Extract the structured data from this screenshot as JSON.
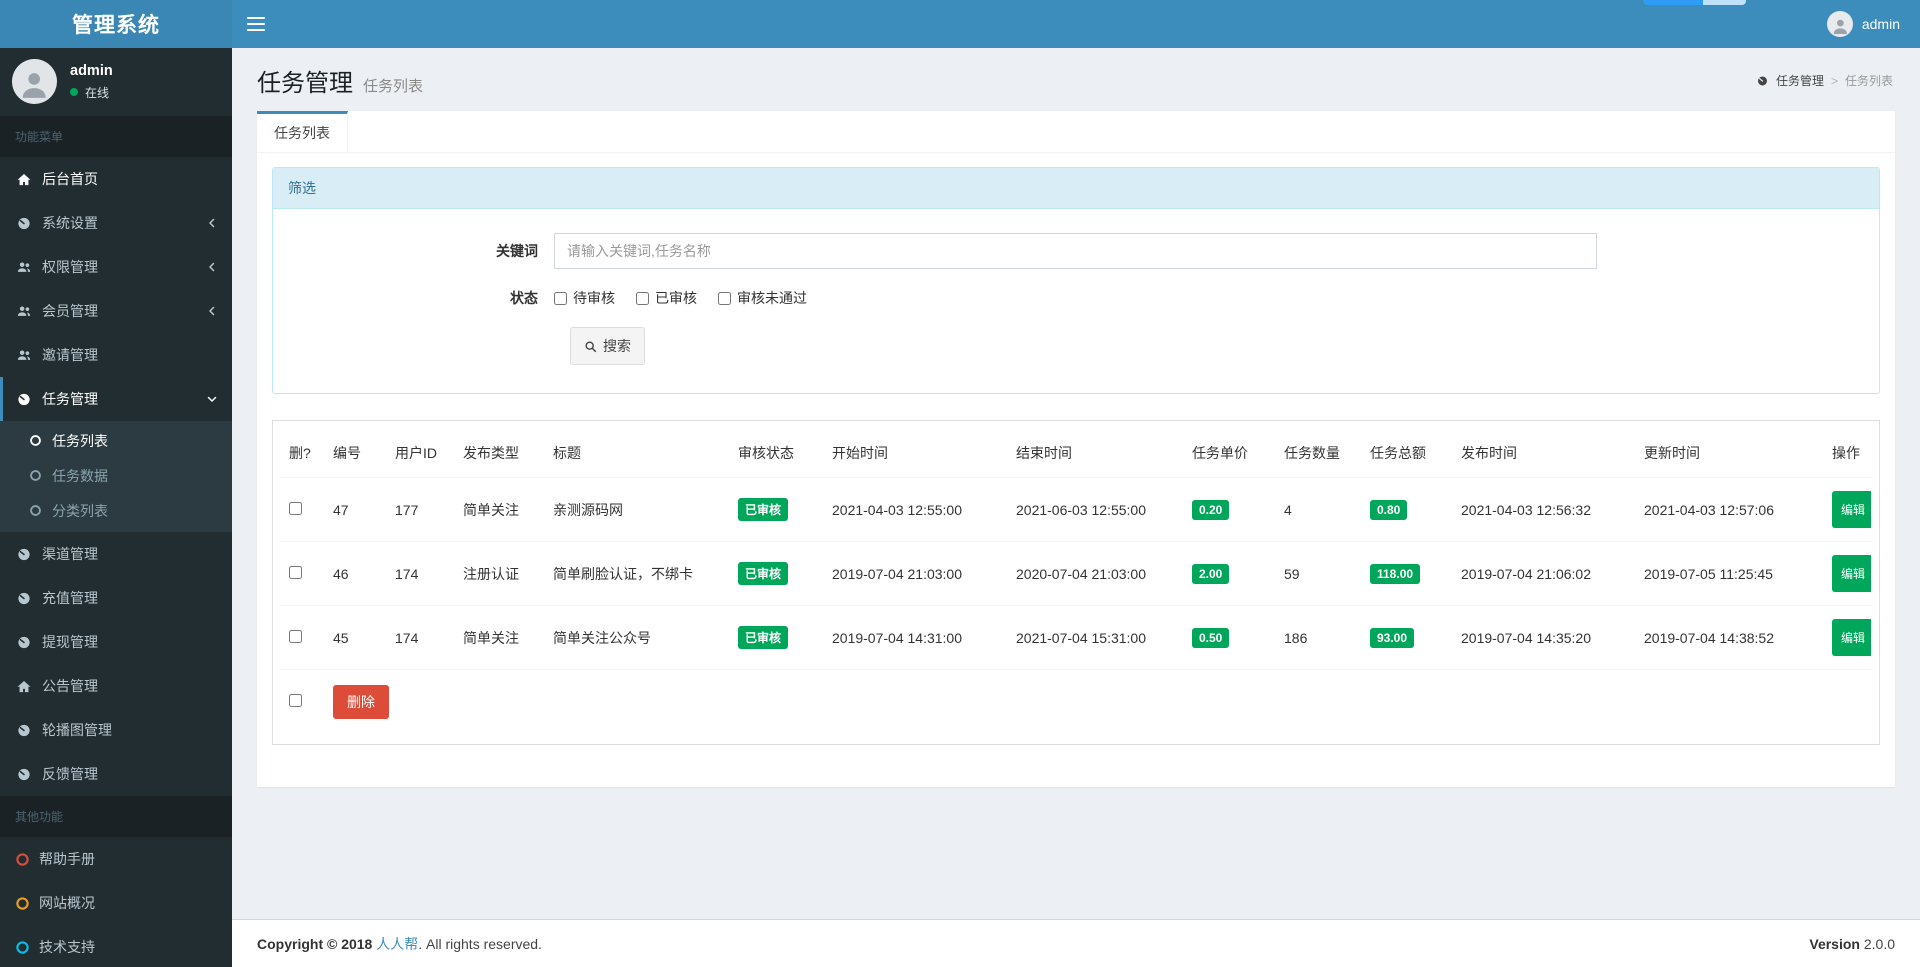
{
  "app": {
    "title": "管理系统"
  },
  "topbar": {
    "username": "admin"
  },
  "sidebar": {
    "user": {
      "name": "admin",
      "status": "在线"
    },
    "menu_header": "功能菜单",
    "items": [
      {
        "label": "后台首页",
        "icon": "home"
      },
      {
        "label": "系统设置",
        "icon": "gauge"
      },
      {
        "label": "权限管理",
        "icon": "users"
      },
      {
        "label": "会员管理",
        "icon": "users"
      },
      {
        "label": "邀请管理",
        "icon": "users"
      },
      {
        "label": "任务管理",
        "icon": "gauge",
        "active": true,
        "children": [
          {
            "label": "任务列表",
            "active": true
          },
          {
            "label": "任务数据"
          },
          {
            "label": "分类列表"
          }
        ]
      },
      {
        "label": "渠道管理",
        "icon": "gauge"
      },
      {
        "label": "充值管理",
        "icon": "gauge"
      },
      {
        "label": "提现管理",
        "icon": "gauge"
      },
      {
        "label": "公告管理",
        "icon": "home"
      },
      {
        "label": "轮播图管理",
        "icon": "gauge"
      },
      {
        "label": "反馈管理",
        "icon": "gauge"
      }
    ],
    "other_header": "其他功能",
    "other_items": [
      {
        "label": "帮助手册",
        "color": "#dd4b39"
      },
      {
        "label": "网站概况",
        "color": "#f39c12"
      },
      {
        "label": "技术支持",
        "color": "#00c0ef"
      }
    ]
  },
  "content_header": {
    "title": "任务管理",
    "subtitle": "任务列表",
    "breadcrumb": {
      "root": "任务管理",
      "separator": ">",
      "current": "任务列表"
    }
  },
  "tab": {
    "label": "任务列表"
  },
  "filter": {
    "header": "筛选",
    "keyword_label": "关键词",
    "keyword_placeholder": "请输入关键词,任务名称",
    "keyword_value": "",
    "status_label": "状态",
    "status_options": [
      {
        "label": "待审核",
        "checked": false
      },
      {
        "label": "已审核",
        "checked": false
      },
      {
        "label": "审核未通过",
        "checked": false
      }
    ],
    "search_label": "搜索"
  },
  "table": {
    "headers": [
      "删?",
      "编号",
      "用户ID",
      "发布类型",
      "标题",
      "审核状态",
      "开始时间",
      "结束时间",
      "任务单价",
      "任务数量",
      "任务总额",
      "发布时间",
      "更新时间",
      "操作"
    ],
    "rows": [
      {
        "id": "47",
        "user_id": "177",
        "type": "简单关注",
        "title": "亲测源码网",
        "status": "已审核",
        "start": "2021-04-03 12:55:00",
        "end": "2021-06-03 12:55:00",
        "price": "0.20",
        "count": "4",
        "total": "0.80",
        "publish": "2021-04-03 12:56:32",
        "update": "2021-04-03 12:57:06",
        "action": "编辑"
      },
      {
        "id": "46",
        "user_id": "174",
        "type": "注册认证",
        "title": "简单刷脸认证，不绑卡",
        "status": "已审核",
        "start": "2019-07-04 21:03:00",
        "end": "2020-07-04 21:03:00",
        "price": "2.00",
        "count": "59",
        "total": "118.00",
        "publish": "2019-07-04 21:06:02",
        "update": "2019-07-05 11:25:45",
        "action": "编辑"
      },
      {
        "id": "45",
        "user_id": "174",
        "type": "简单关注",
        "title": "简单关注公众号",
        "status": "已审核",
        "start": "2019-07-04 14:31:00",
        "end": "2021-07-04 15:31:00",
        "price": "0.50",
        "count": "186",
        "total": "93.00",
        "publish": "2019-07-04 14:35:20",
        "update": "2019-07-04 14:38:52",
        "action": "编辑"
      }
    ],
    "delete_label": "删除"
  },
  "footer": {
    "copyright_prefix": "Copyright © 2018",
    "brand": "人人帮",
    "copyright_suffix": ". All rights reserved.",
    "version_label": "Version",
    "version": "2.0.0"
  },
  "colors": {
    "navbar": "#3c8dbc",
    "sidebar": "#222d32",
    "success": "#00a65a",
    "danger": "#dd4b39",
    "warning": "#f39c12",
    "info": "#00c0ef",
    "filter_header_bg": "#d9edf7"
  }
}
